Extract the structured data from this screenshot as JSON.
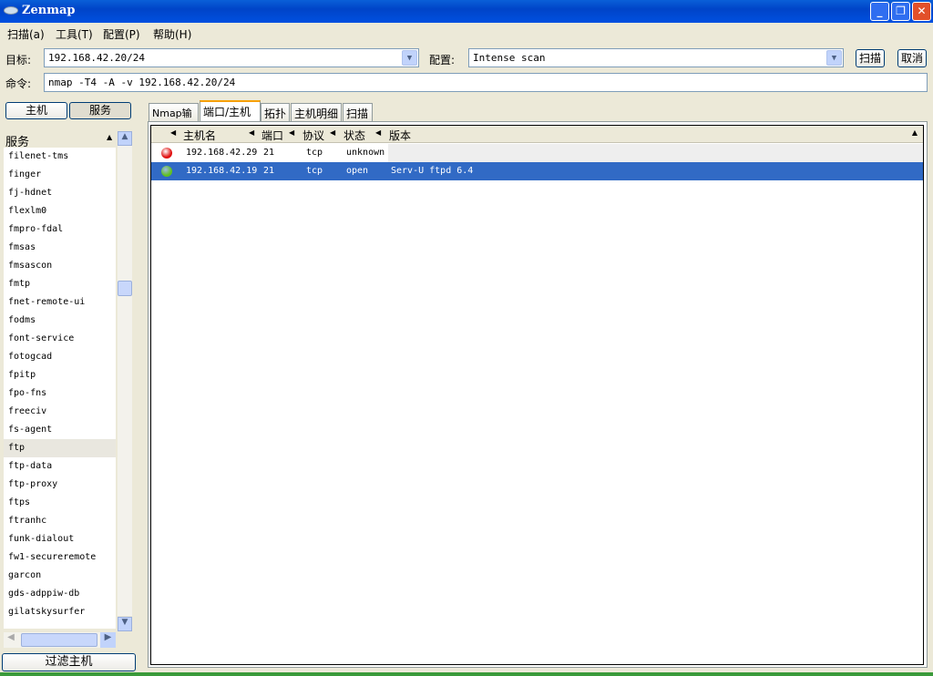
{
  "window": {
    "title": "Zenmap",
    "minimize": "_",
    "restore": "❐",
    "close": "✕"
  },
  "menu": [
    "扫描(a)",
    "工具(T)",
    "配置(P)",
    "帮助(H)"
  ],
  "target": {
    "label": "目标:",
    "value": "192.168.42.20/24"
  },
  "profile": {
    "label": "配置:",
    "value": "Intense scan"
  },
  "buttons": {
    "scan": "扫描",
    "cancel": "取消",
    "hosts": "主机",
    "services": "服务",
    "filter": "过滤主机"
  },
  "command": {
    "label": "命令:",
    "value": "nmap -T4 -A -v 192.168.42.20/24"
  },
  "services_header": "服务",
  "services": [
    "filenet-tms",
    "finger",
    "fj-hdnet",
    "flexlm0",
    "fmpro-fdal",
    "fmsas",
    "fmsascon",
    "fmtp",
    "fnet-remote-ui",
    "fodms",
    "font-service",
    "fotogcad",
    "fpitp",
    "fpo-fns",
    "freeciv",
    "fs-agent",
    "ftp",
    "ftp-data",
    "ftp-proxy",
    "ftps",
    "ftranhc",
    "funk-dialout",
    "fw1-secureremote",
    "garcon",
    "gds-adppiw-db",
    "gilatskysurfer"
  ],
  "selected_service": "ftp",
  "tabs": [
    "Nmap输出",
    "端口/主机",
    "拓扑",
    "主机明细",
    "扫描"
  ],
  "active_tab": "端口/主机",
  "columns": [
    "主机名",
    "端口",
    "协议",
    "状态",
    "版本"
  ],
  "rows": [
    {
      "status_color": "#e01010",
      "host": "192.168.42.29",
      "port": "21",
      "protocol": "tcp",
      "state": "unknown",
      "version": "",
      "selected": false
    },
    {
      "status_color": "#60c020",
      "host": "192.168.42.19",
      "port": "21",
      "protocol": "tcp",
      "state": "open",
      "version": "Serv-U ftpd 6.4",
      "selected": true
    }
  ],
  "colors": {
    "selection": "#316ac5",
    "titlebar": "#0054e3"
  }
}
